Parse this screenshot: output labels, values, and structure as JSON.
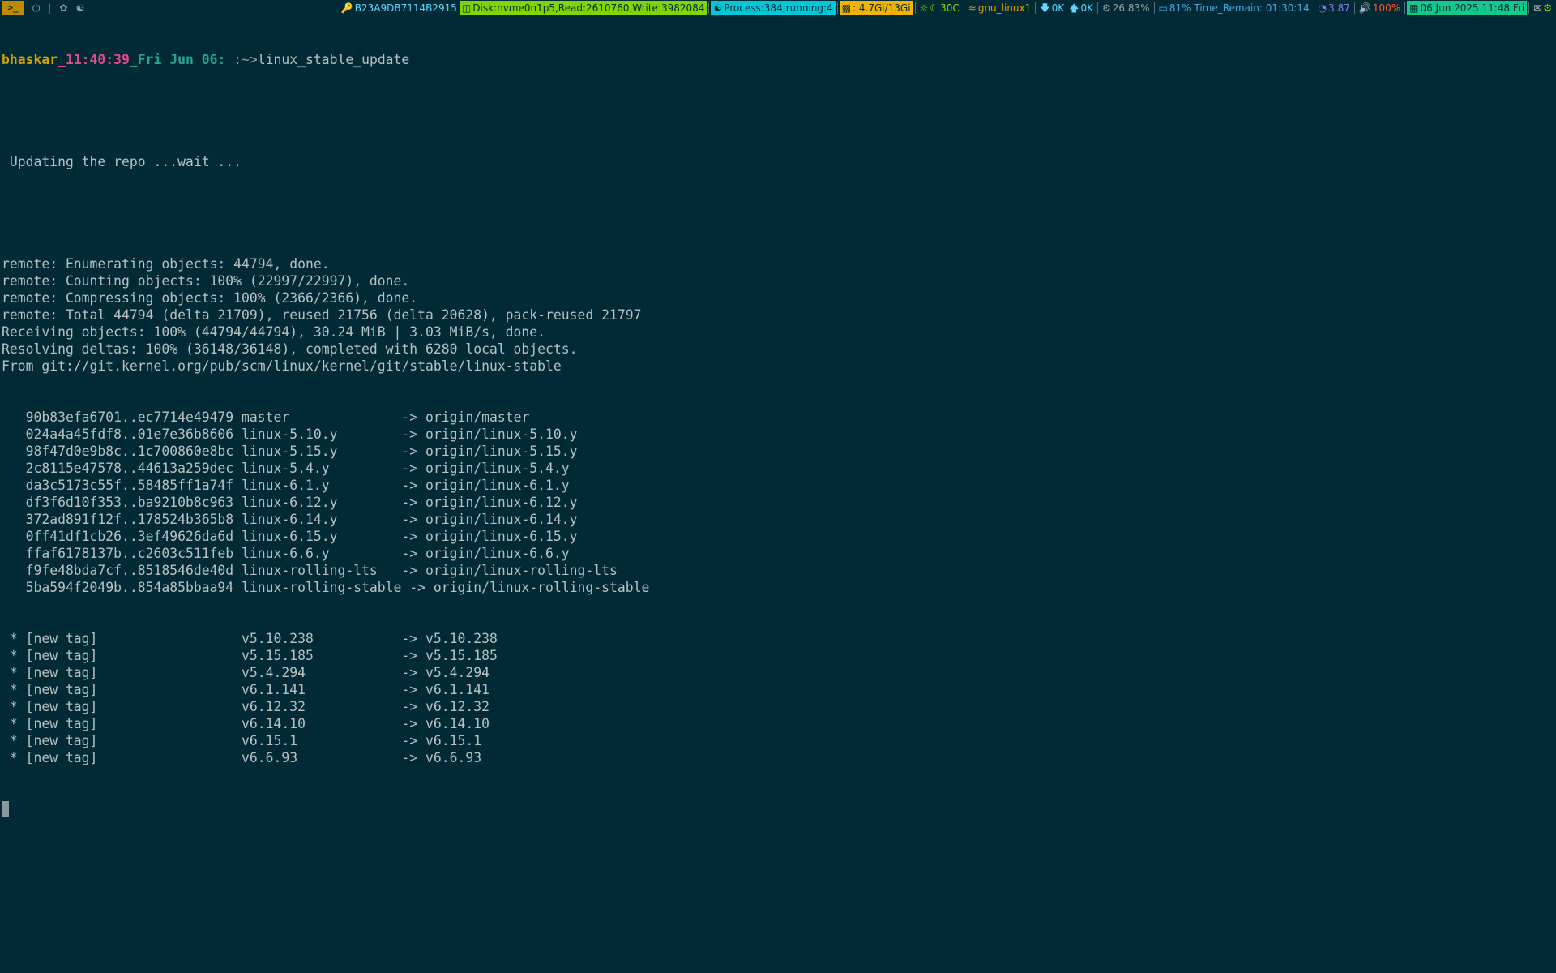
{
  "statusbar": {
    "terminal_button": ">_",
    "workspace_icons": [
      "power-icon",
      "leaf-icon",
      "linux-icon"
    ],
    "key_id": "B23A9DB7114B2915",
    "disk": "Disk:nvme0n1p5,Read:2610760,Write:3982084",
    "process": "Process:384;running:4",
    "memory": ": 4.7Gi/13Gi",
    "temp": "30C",
    "wifi": "gnu_linux1",
    "net_down": "0K",
    "net_up": "0K",
    "cpu": "26.83%",
    "battery": "81% Time_Remain: 01:30:14",
    "load": "3.87",
    "volume": "100%",
    "date": "06 Jun 2025 11:48 Fri",
    "colors": {
      "background": "#002b36",
      "terminal_button": "#c08a00",
      "disk_highlight": "#7fd600",
      "process_highlight": "#00c8d8",
      "memory_highlight": "#f0b400",
      "date_highlight": "#14c88c"
    }
  },
  "prompt": {
    "user": "bhaskar",
    "time": "_11:40:39",
    "date": "_Fri Jun 06:",
    "path": " :~>",
    "command": "linux_stable_update"
  },
  "output": {
    "blank1": "",
    "updating": " Updating the repo ...wait ...",
    "blank2": "",
    "lines": [
      "remote: Enumerating objects: 44794, done.",
      "remote: Counting objects: 100% (22997/22997), done.",
      "remote: Compressing objects: 100% (2366/2366), done.",
      "remote: Total 44794 (delta 21709), reused 21756 (delta 20628), pack-reused 21797",
      "Receiving objects: 100% (44794/44794), 30.24 MiB | 3.03 MiB/s, done.",
      "Resolving deltas: 100% (36148/36148), completed with 6280 local objects.",
      "From git://git.kernel.org/pub/scm/linux/kernel/git/stable/linux-stable"
    ],
    "branches": [
      {
        "range": "90b83efa6701..ec7714e49479",
        "local": "master",
        "remote": "origin/master"
      },
      {
        "range": "024a4a45fdf8..01e7e36b8606",
        "local": "linux-5.10.y",
        "remote": "origin/linux-5.10.y"
      },
      {
        "range": "98f47d0e9b8c..1c700860e8bc",
        "local": "linux-5.15.y",
        "remote": "origin/linux-5.15.y"
      },
      {
        "range": "2c8115e47578..44613a259dec",
        "local": "linux-5.4.y",
        "remote": "origin/linux-5.4.y"
      },
      {
        "range": "da3c5173c55f..58485ff1a74f",
        "local": "linux-6.1.y",
        "remote": "origin/linux-6.1.y"
      },
      {
        "range": "df3f6d10f353..ba9210b8c963",
        "local": "linux-6.12.y",
        "remote": "origin/linux-6.12.y"
      },
      {
        "range": "372ad891f12f..178524b365b8",
        "local": "linux-6.14.y",
        "remote": "origin/linux-6.14.y"
      },
      {
        "range": "0ff41df1cb26..3ef49626da6d",
        "local": "linux-6.15.y",
        "remote": "origin/linux-6.15.y"
      },
      {
        "range": "ffaf6178137b..c2603c511feb",
        "local": "linux-6.6.y",
        "remote": "origin/linux-6.6.y"
      },
      {
        "range": "f9fe48bda7cf..8518546de40d",
        "local": "linux-rolling-lts",
        "remote": "origin/linux-rolling-lts"
      },
      {
        "range": "5ba594f2049b..854a85bbaa94",
        "local": "linux-rolling-stable",
        "remote": "origin/linux-rolling-stable"
      }
    ],
    "tags": [
      {
        "label": "[new tag]",
        "local": "v5.10.238",
        "remote": "v5.10.238"
      },
      {
        "label": "[new tag]",
        "local": "v5.15.185",
        "remote": "v5.15.185"
      },
      {
        "label": "[new tag]",
        "local": "v5.4.294",
        "remote": "v5.4.294"
      },
      {
        "label": "[new tag]",
        "local": "v6.1.141",
        "remote": "v6.1.141"
      },
      {
        "label": "[new tag]",
        "local": "v6.12.32",
        "remote": "v6.12.32"
      },
      {
        "label": "[new tag]",
        "local": "v6.14.10",
        "remote": "v6.14.10"
      },
      {
        "label": "[new tag]",
        "local": "v6.15.1",
        "remote": "v6.15.1"
      },
      {
        "label": "[new tag]",
        "local": "v6.6.93",
        "remote": "v6.6.93"
      }
    ]
  }
}
